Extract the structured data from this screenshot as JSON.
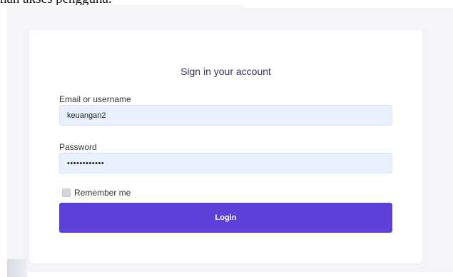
{
  "document": {
    "caption": "nan akses pengguna."
  },
  "login": {
    "title": "Sign in your account",
    "email_label": "Email or username",
    "email_value": "keuangan2",
    "password_label": "Password",
    "password_value": "••••••••••••",
    "remember_label": "Remember me",
    "remember_checked": false,
    "login_button": "Login"
  },
  "colors": {
    "page_background": "#f4f5f9",
    "card_background": "#ffffff",
    "input_background": "#e8f0fe",
    "button_accent": "#5e3fd9",
    "button_text": "#ffffff"
  }
}
